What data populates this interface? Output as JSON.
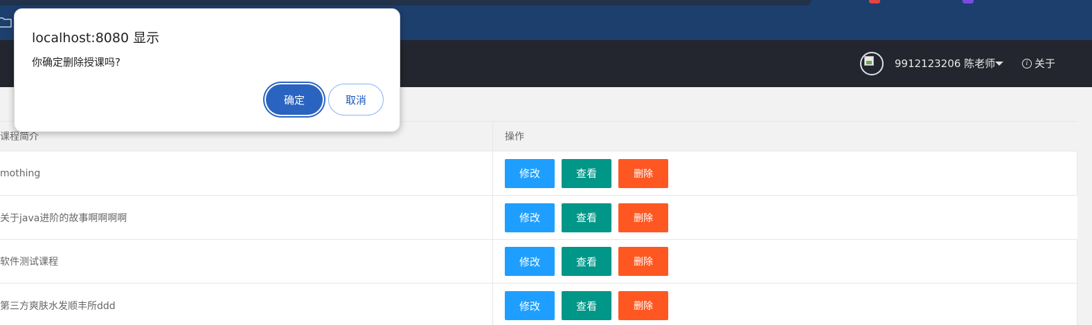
{
  "browser": {
    "extension_colors": [
      "#e34343",
      "#7b4ae2"
    ]
  },
  "header": {
    "user_label": "9912123206 陈老师",
    "about_label": "关于"
  },
  "table": {
    "columns": [
      "课程简介",
      "操作"
    ],
    "rows": [
      {
        "intro": "mothing"
      },
      {
        "intro": "关于java进阶的故事啊啊啊啊"
      },
      {
        "intro": "软件测试课程"
      },
      {
        "intro": "第三方爽肤水发顺丰所ddd"
      }
    ],
    "actions": {
      "edit": "修改",
      "view": "查看",
      "delete": "删除"
    }
  },
  "dialog": {
    "title": "localhost:8080 显示",
    "message": "你确定删除授课吗?",
    "ok_label": "确定",
    "cancel_label": "取消"
  },
  "colors": {
    "header_bg": "#23262e",
    "browser_bg": "#1d3f6e",
    "edit": "#1e9fff",
    "view": "#009688",
    "delete": "#ff5722",
    "dialog_primary": "#2b64c0"
  }
}
